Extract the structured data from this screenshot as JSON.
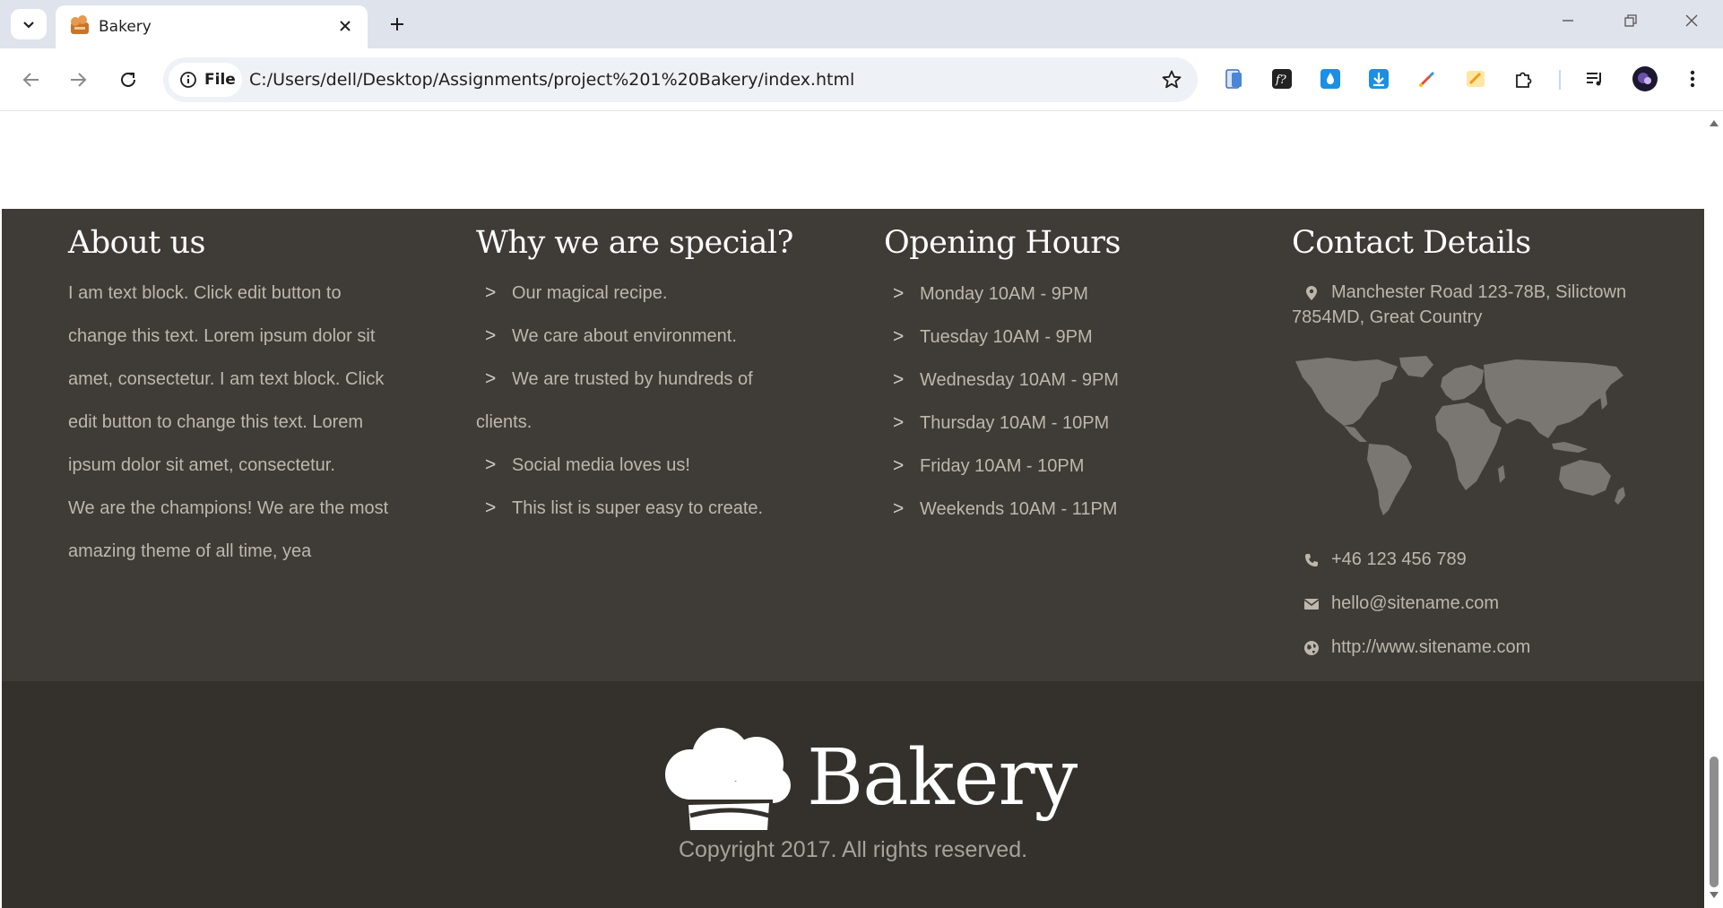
{
  "browser": {
    "tab_title": "Bakery",
    "chip_label": "File",
    "url": "C:/Users/dell/Desktop/Assignments/project%201%20Bakery/index.html",
    "extensions": [
      "phone-icon",
      "fx-icon",
      "drop-icon",
      "download-icon",
      "pen-icon",
      "highlighter-icon",
      "puzzle-icon",
      "media-icon",
      "profile-avatar"
    ]
  },
  "footer": {
    "about": {
      "heading": "About us",
      "lines": [
        "I am text block. Click edit button to",
        "change this text. Lorem ipsum dolor sit",
        "amet, consectetur. I am text block. Click",
        "edit button to change this text. Lorem",
        "ipsum dolor sit amet, consectetur.",
        "We are the champions! We are the most",
        "amazing theme of all time, yea"
      ]
    },
    "special": {
      "heading": "Why we are special?",
      "items": [
        "Our magical recipe.",
        "We care about environment.",
        "We are trusted by hundreds of",
        "Social media loves us!",
        "This list is super easy to create."
      ],
      "wrap_text": "clients."
    },
    "hours": {
      "heading": "Opening Hours",
      "items": [
        "Monday 10AM - 9PM",
        "Tuesday 10AM - 9PM",
        "Wednesday 10AM - 9PM",
        "Thursday 10AM - 10PM",
        "Friday 10AM - 10PM",
        "Weekends 10AM - 11PM"
      ]
    },
    "contact": {
      "heading": "Contact Details",
      "address_line1": "Manchester Road 123-78B, Silictown",
      "address_line2": "7854MD, Great Country",
      "phone": "+46 123 456 789",
      "email": "hello@sitename.com",
      "website": "http://www.sitename.com"
    },
    "brand_name": "Bakery",
    "copyright": "Copyright 2017. All rights reserved."
  },
  "colors": {
    "footer_top": "#3f3b37",
    "footer_bottom": "#34312d",
    "text_muted": "#bdb7ae",
    "heading": "#ffffff"
  }
}
